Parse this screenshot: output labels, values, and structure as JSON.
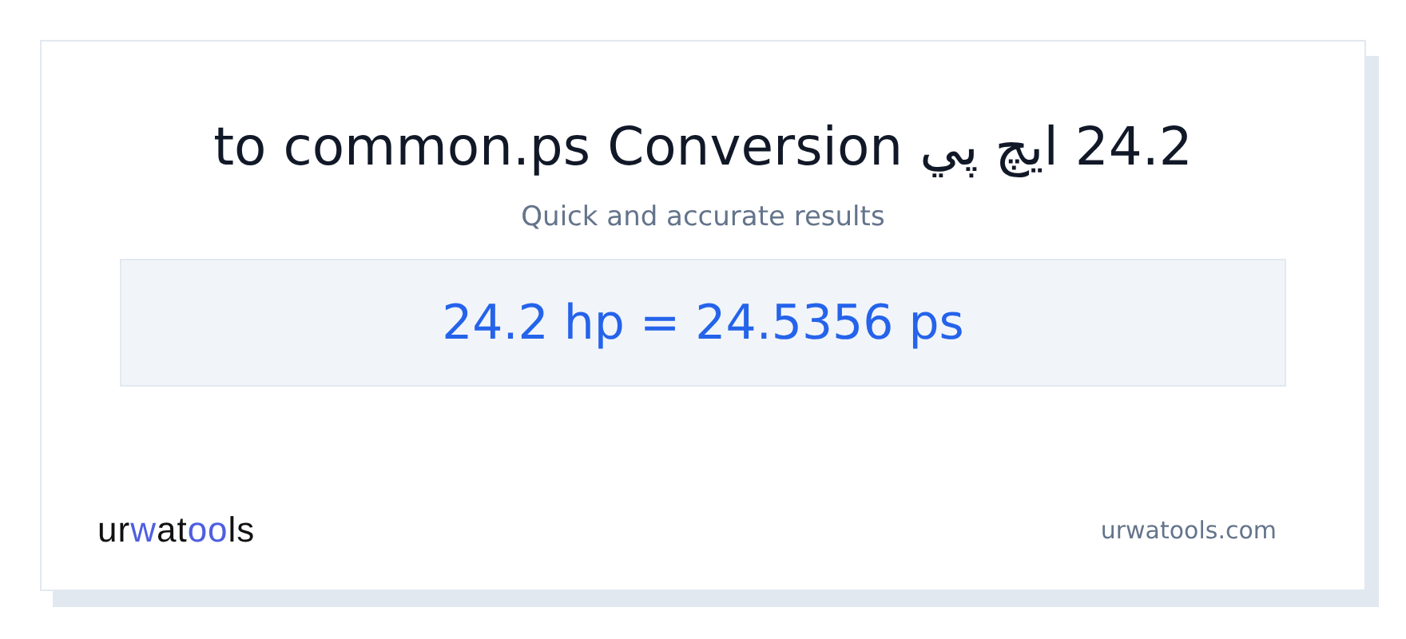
{
  "title": "24.2 ایچ پي to common.ps Conversion",
  "subtitle": "Quick and accurate results",
  "result": "24.2 hp = 24.5356 ps",
  "logo": {
    "parts": [
      {
        "text": "ur",
        "accent": false
      },
      {
        "text": "w",
        "accent": true
      },
      {
        "text": "at",
        "accent": false
      },
      {
        "text": "oo",
        "accent": true
      },
      {
        "text": "ls",
        "accent": false
      }
    ]
  },
  "site": "urwatools.com"
}
